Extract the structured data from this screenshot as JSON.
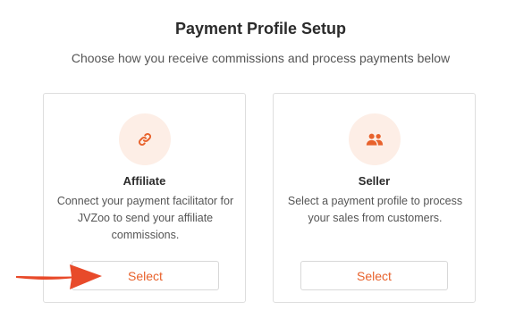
{
  "header": {
    "title": "Payment Profile Setup",
    "subtitle": "Choose how you receive commissions and process payments below"
  },
  "cards": [
    {
      "icon": "link-icon",
      "title": "Affiliate",
      "description": "Connect your payment facilitator for JVZoo to send your affiliate commissions.",
      "button_label": "Select"
    },
    {
      "icon": "users-icon",
      "title": "Seller",
      "description": "Select a payment profile to process your sales from customers.",
      "button_label": "Select"
    }
  ],
  "colors": {
    "accent": "#e8622c",
    "icon_background": "#fdeee6",
    "annotation_arrow": "#e84a2a"
  }
}
